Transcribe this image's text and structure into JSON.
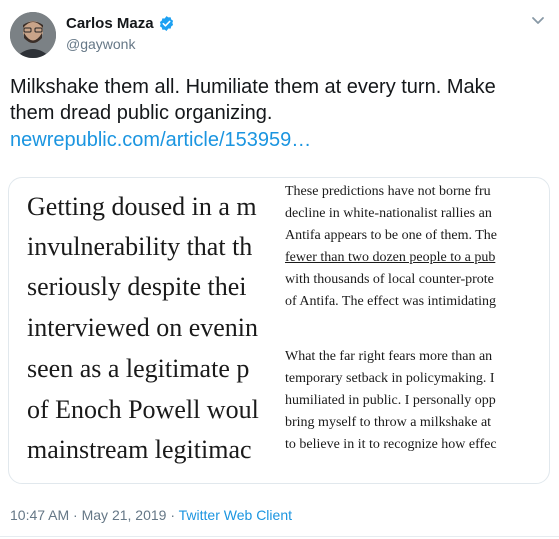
{
  "author": {
    "display_name": "Carlos Maza",
    "handle": "@gaywonk",
    "verified_icon": "verified-badge-icon",
    "accent": "#1da1f2"
  },
  "tweet": {
    "text": "Milkshake them all. Humiliate them at every turn. Make them dread public organizing.",
    "link": "newrepublic.com/article/153959…"
  },
  "card": {
    "left_lines": [
      "Getting doused in a m",
      "invulnerability that th",
      "seriously despite thei",
      "interviewed on evenin",
      "seen as a legitimate p",
      "of Enoch Powell woul",
      "mainstream legitimac"
    ],
    "right_lines_1": [
      "These predictions have not borne fru",
      "decline in white-nationalist rallies an",
      "Antifa appears to be one of them. The",
      "fewer than two dozen people to a pub",
      "with thousands of local counter-prote",
      "of Antifa. The effect was intimidating"
    ],
    "right_lines_2": [
      "What the far right fears more than an",
      "temporary setback in policymaking. I",
      "humiliated in public. I personally opp",
      "bring myself to throw a milkshake at",
      "to believe in it to recognize how effec"
    ]
  },
  "meta": {
    "time": "10:47 AM",
    "sep1": "·",
    "date": "May 21, 2019",
    "sep2": "·",
    "client": "Twitter Web Client"
  },
  "colors": {
    "link": "#1b95e0",
    "secondary_text": "#657786",
    "border": "#e1e8ed"
  }
}
